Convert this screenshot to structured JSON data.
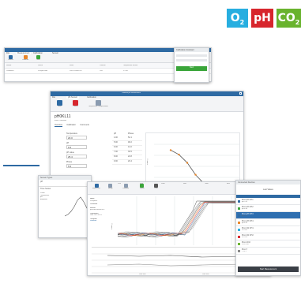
{
  "logos": [
    {
      "text": "O",
      "sub": "2",
      "color": "#27aee0"
    },
    {
      "text": "pH",
      "sub": "",
      "color": "#d7262d"
    },
    {
      "text": "CO",
      "sub": "2",
      "color": "#69b32e"
    }
  ],
  "win1": {
    "tabs": [
      "File",
      "Measurement",
      "Calibration",
      "Sensor"
    ],
    "ribbon_buttons": [
      "Connect",
      "Calibrate",
      "Start"
    ],
    "table_headers": [
      "Sensor",
      "Device",
      "Serial",
      "Channel",
      "Temperature Sensor"
    ],
    "row": [
      "Lumiox001",
      "Pico-pH-Flow",
      "PHPIC000002317",
      "CH1",
      "PT100"
    ],
    "panel_title": "Calibration Assistant",
    "panel_button": "Next"
  },
  "win2": {
    "title": "Calibrate pH Measurement",
    "tabs": [
      "File",
      "pH-Sensor",
      "Calibration"
    ],
    "ribbon_buttons": [
      "Save",
      "Cancel",
      "Temperature Compensation"
    ],
    "sensor_id": "pH0KL11",
    "subtitle": "Enter a comment",
    "subtabs": [
      "Overview",
      "Calibration",
      "Comments"
    ],
    "fields": [
      "Temperature",
      "pH",
      "pH value",
      "Phase"
    ],
    "values": [
      "20.0",
      "6.5",
      "25.4",
      "5.5"
    ],
    "table_headers": [
      "pH",
      "Phase"
    ],
    "table": [
      [
        "4.00",
        "52.1"
      ],
      [
        "5.00",
        "48.2"
      ],
      [
        "6.00",
        "41.0"
      ],
      [
        "7.00",
        "30.5"
      ],
      [
        "8.00",
        "22.8"
      ],
      [
        "9.00",
        "20.4"
      ]
    ],
    "ylabel": "Phase [°]",
    "xticks": [
      "2",
      "4",
      "6",
      "8",
      "10",
      "12"
    ]
  },
  "win3": {
    "panel_title": "Sensor Types",
    "panel_value": "pH",
    "time_series": "Time Series",
    "legend_items": [
      "Phase",
      "Temperature",
      "pH",
      "Amplitude"
    ]
  },
  "win4": {
    "ribbon_buttons": [
      "Import Data",
      "Merge",
      "Compare",
      "Export",
      "Print"
    ],
    "info_labels": [
      "Name",
      "Comment",
      "Sensor",
      "Calibration",
      "Template"
    ],
    "info_values": [
      "Pico-pH01",
      "",
      "pH-Flow sensor no.1",
      "Date 2021-04-12",
      "Standard"
    ],
    "top_ticks": [
      "1000",
      "2000",
      "3000",
      "4000",
      "5000",
      "6000",
      "7000"
    ],
    "ylabel": "Phase [°]",
    "x_bottom": [
      "Date time",
      "Date time"
    ],
    "status": [
      "Connected",
      "Logging"
    ]
  },
  "right_panel": {
    "title": "Connected Devices",
    "subtitle": "Last Values",
    "items": [
      {
        "name": "Pico-pH CH1",
        "val": "pH 7.05",
        "selected": false
      },
      {
        "name": "Pico-pH CH2",
        "val": "pH 6.98",
        "selected": false
      },
      {
        "name": "Pico-pH CH3",
        "val": "pH 7.12",
        "selected": true
      },
      {
        "name": "Pico-pH CH4",
        "val": "pH 6.95",
        "selected": false
      },
      {
        "name": "Pico-O2 CH1",
        "val": "O2 20.9",
        "selected": false
      },
      {
        "name": "Pico-O2 CH2",
        "val": "O2 21.0",
        "selected": false
      },
      {
        "name": "Pico-CO2",
        "val": "CO2 0.04",
        "selected": false
      },
      {
        "name": "Pico-T",
        "val": "T 25.1",
        "selected": false
      }
    ],
    "button": "Start Measurement"
  },
  "colors": {
    "blue": "#2e6aa3",
    "accent": "#3aa53a",
    "orange": "#e8862a"
  }
}
